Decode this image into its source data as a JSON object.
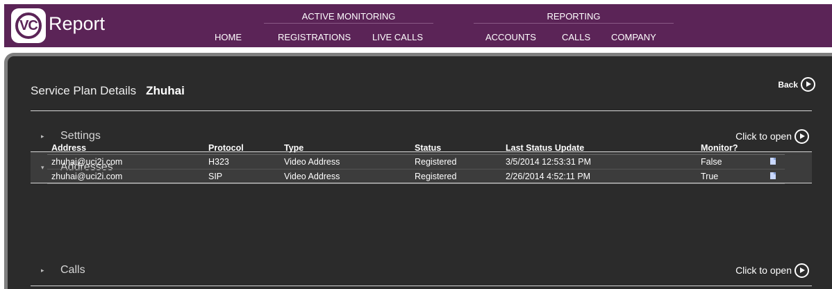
{
  "header": {
    "logo_mark": "VC",
    "logo_text": "Report",
    "groups": {
      "active_monitoring": "ACTIVE MONITORING",
      "reporting": "REPORTING"
    },
    "nav": {
      "home": "HOME",
      "registrations": "REGISTRATIONS",
      "live_calls": "LIVE CALLS",
      "accounts": "ACCOUNTS",
      "calls": "CALLS",
      "company": "COMPANY"
    },
    "brand_color": "#5b2457"
  },
  "page": {
    "title": "Service Plan Details",
    "plan_name": "Zhuhai",
    "back_label": "Back"
  },
  "sections": {
    "settings": {
      "label": "Settings",
      "link": "Click to open",
      "expanded": false
    },
    "addresses": {
      "label": "Addresses",
      "expanded": true
    },
    "calls": {
      "label": "Calls",
      "link": "Click to open",
      "expanded": false
    }
  },
  "addresses_table": {
    "columns": [
      "Address",
      "Protocol",
      "Type",
      "Status",
      "Last Status Update",
      "Monitor?"
    ],
    "rows": [
      {
        "address": "zhuhai@uci2i.com",
        "protocol": "H323",
        "type": "Video Address",
        "status": "Registered",
        "last_update": "3/5/2014 12:53:31 PM",
        "monitor": "False",
        "icon": "document-icon"
      },
      {
        "address": "zhuhai@uci2i.com",
        "protocol": "SIP",
        "type": "Video Address",
        "status": "Registered",
        "last_update": "2/26/2014 4:52:11 PM",
        "monitor": "True",
        "icon": "document-icon"
      }
    ]
  }
}
